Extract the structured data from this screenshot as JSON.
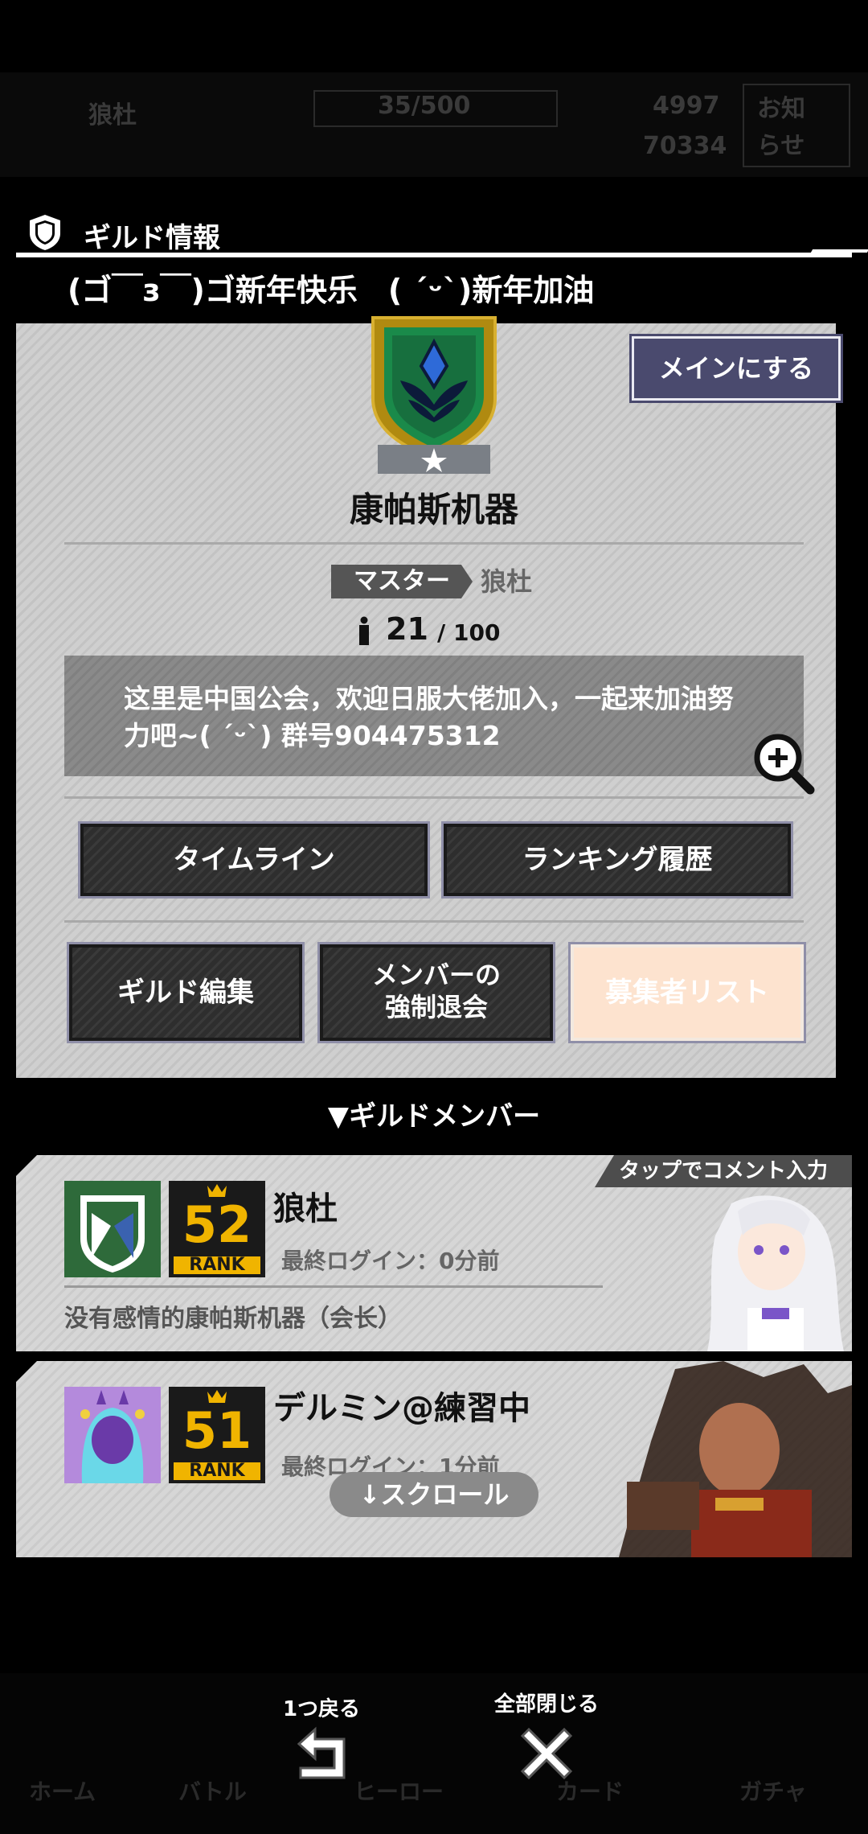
{
  "background_bar": {
    "label1": "狼杜",
    "count": "35/500",
    "val1": "4997",
    "val2": "70334",
    "notice_top": "お知",
    "notice_bottom": "らせ"
  },
  "header": {
    "title": "ギルド情報"
  },
  "guild": {
    "message": "(ゴ￣з￣)ゴ新年快乐　( ´ᵕ`)新年加油",
    "name": "康帕斯机器",
    "main_button": "メインにする",
    "master_label": "マスター",
    "master_name": "狼杜",
    "member_current": "21",
    "member_max": "/ 100",
    "description": "这里是中国公会，欢迎日服大佬加入，一起来加油努力吧~( ´ᵕ`) 群号904475312"
  },
  "actions": {
    "timeline": "タイムライン",
    "ranking_history": "ランキング履歴",
    "guild_edit": "ギルド編集",
    "kick_line1": "メンバーの",
    "kick_line2": "強制退会",
    "applicants": "募集者リスト"
  },
  "members_section": {
    "title": "▼ギルドメンバー"
  },
  "members": [
    {
      "name": "狼杜",
      "rank_num": "52",
      "rank_label": "RANK",
      "last_login": "最終ログイン：0分前",
      "comment": "没有感情的康帕斯机器（会长）",
      "tap_hint": "タップでコメント入力"
    },
    {
      "name": "デルミン@練習中",
      "rank_num": "51",
      "rank_label": "RANK",
      "last_login": "最終ログイン：1分前"
    }
  ],
  "scroll_hint": "↓スクロール",
  "footer": {
    "back_label": "1つ戻る",
    "close_all_label": "全部閉じる",
    "tabs": [
      "ホーム",
      "バトル",
      "ヒーロー",
      "カード",
      "ガチャ"
    ]
  },
  "colors": {
    "main_button_bg": "#4a4a6e",
    "emblem_gold": "#b08a10",
    "emblem_green": "#1a8a4a",
    "rank_gold": "#f0b400",
    "applicants_bg": "#fde3cf"
  }
}
